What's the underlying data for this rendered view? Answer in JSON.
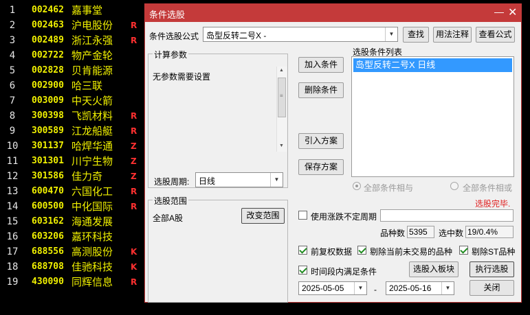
{
  "stock_rows": [
    {
      "idx": "1",
      "code": "002462",
      "name": "嘉事堂",
      "flag": ""
    },
    {
      "idx": "2",
      "code": "002463",
      "name": "沪电股份",
      "flag": "R"
    },
    {
      "idx": "3",
      "code": "002489",
      "name": "浙江永强",
      "flag": "R"
    },
    {
      "idx": "4",
      "code": "002722",
      "name": "物产金轮",
      "flag": ""
    },
    {
      "idx": "5",
      "code": "002828",
      "name": "贝肯能源",
      "flag": ""
    },
    {
      "idx": "6",
      "code": "002900",
      "name": "哈三联",
      "flag": ""
    },
    {
      "idx": "7",
      "code": "003009",
      "name": "中天火箭",
      "flag": ""
    },
    {
      "idx": "8",
      "code": "300398",
      "name": "飞凯材料",
      "flag": "R"
    },
    {
      "idx": "9",
      "code": "300589",
      "name": "江龙船艇",
      "flag": "R"
    },
    {
      "idx": "10",
      "code": "301137",
      "name": "哈焊华通",
      "flag": "Z"
    },
    {
      "idx": "11",
      "code": "301301",
      "name": "川宁生物",
      "flag": "Z"
    },
    {
      "idx": "12",
      "code": "301586",
      "name": "佳力奇",
      "flag": "Z"
    },
    {
      "idx": "13",
      "code": "600470",
      "name": "六国化工",
      "flag": "R"
    },
    {
      "idx": "14",
      "code": "600500",
      "name": "中化国际",
      "flag": "R"
    },
    {
      "idx": "15",
      "code": "603162",
      "name": "海通发展",
      "flag": ""
    },
    {
      "idx": "16",
      "code": "603206",
      "name": "嘉环科技",
      "flag": ""
    },
    {
      "idx": "17",
      "code": "688556",
      "name": "高测股份",
      "flag": "K"
    },
    {
      "idx": "18",
      "code": "688708",
      "name": "佳驰科技",
      "flag": "K"
    },
    {
      "idx": "19",
      "code": "430090",
      "name": "同辉信息",
      "flag": "R"
    }
  ],
  "dialog": {
    "title": "条件选股",
    "minimize_glyph": "—",
    "close_glyph": "✕",
    "formula_label": "条件选股公式",
    "formula_value": "岛型反转二号X -",
    "find_button": "查找",
    "usage_button": "用法注释",
    "view_formula_button": "查看公式",
    "params_group_title": "计算参数",
    "params_text": "无参数需要设置",
    "period_label": "选股周期:",
    "period_value": "日线",
    "range_group_title": "选股范围",
    "range_value": "全部A股",
    "change_range_button": "改变范围",
    "add_condition_button": "加入条件",
    "delete_condition_button": "删除条件",
    "import_scheme_button": "引入方案",
    "save_scheme_button": "保存方案",
    "conditions_list_title": "选股条件列表",
    "conditions": [
      "岛型反转二号X  日线"
    ],
    "radio_and_label": "全部条件相与",
    "radio_or_label": "全部条件相或",
    "status_text": "选股完毕.",
    "use_indefinite_period_label": "使用涨跌不定周期",
    "variety_count_label": "品种数",
    "variety_count_value": "5395",
    "selected_count_label": "选中数",
    "selected_count_value": "19/0.4%",
    "pre_adjust_label": "前复权数据",
    "exclude_untraded_label": "剔除当前未交易的品种",
    "exclude_st_label": "剔除ST品种",
    "time_range_label": "时间段内满足条件",
    "add_to_block_button": "选股入板块",
    "execute_button": "执行选股",
    "date_from": "2025-05-05",
    "date_sep": "-",
    "date_to": "2025-05-16",
    "close_button": "关闭"
  },
  "colors": {
    "titlebar": "#c43a3a",
    "stock_text": "#f0f000",
    "flag_red": "#ff3030",
    "selection_blue": "#3399ff",
    "status_red": "#e02020"
  }
}
